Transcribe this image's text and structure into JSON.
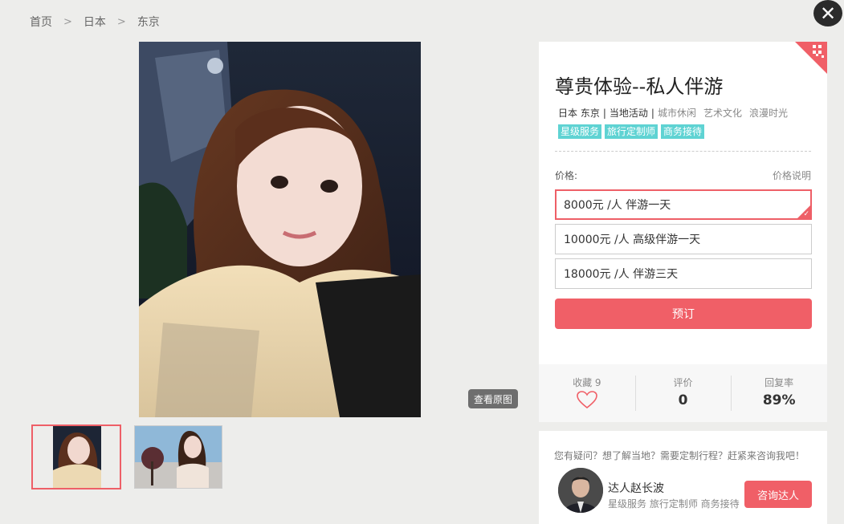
{
  "breadcrumb": [
    "首页",
    "日本",
    "东京"
  ],
  "close_icon": "✕",
  "gallery": {
    "view_original_label": "查看原图",
    "thumbnails": [
      "thumb-1",
      "thumb-2"
    ]
  },
  "product": {
    "title": "尊贵体验--私人伴游",
    "location": "日本 东京",
    "category": "当地活动",
    "subcategories": [
      "城市休闲",
      "艺术文化",
      "浪漫时光"
    ],
    "tags": [
      "星级服务",
      "旅行定制师",
      "商务接待"
    ],
    "price_label": "价格:",
    "price_note": "价格说明",
    "options": [
      {
        "text": "8000元 /人  伴游一天",
        "selected": true
      },
      {
        "text": "10000元 /人  高级伴游一天",
        "selected": false
      },
      {
        "text": "18000元 /人  伴游三天",
        "selected": false
      }
    ],
    "book_label": "预订"
  },
  "stats": {
    "favorites_label": "收藏 9",
    "rating_label": "评价",
    "rating_value": "0",
    "reply_label": "回复率",
    "reply_value": "89%"
  },
  "consult": {
    "question": "您有疑问？想了解当地？需要定制行程？赶紧来咨询我吧！",
    "expert_name": "达人赵长波",
    "expert_tags": "星级服务  旅行定制师  商务接待",
    "ask_label": "咨询达人"
  },
  "colors": {
    "accent": "#f05f67",
    "tag": "#5fd3d3"
  }
}
